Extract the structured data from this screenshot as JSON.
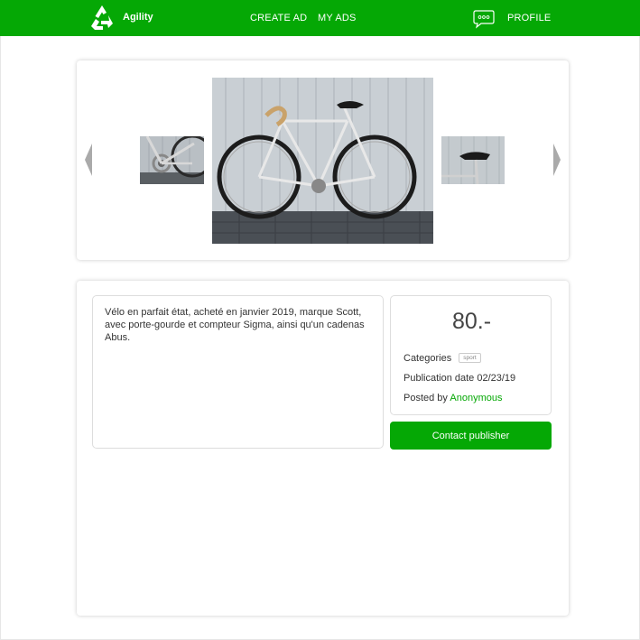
{
  "header": {
    "brand": "Agility",
    "nav": {
      "create_ad": "CREATE AD",
      "my_ads": "MY ADS",
      "profile": "PROFILE"
    },
    "icons": {
      "logo": "recycle-logo-icon",
      "messages": "chat-bubble-icon"
    },
    "accent_color": "#05a805"
  },
  "gallery": {
    "icons": {
      "prev": "arrow-left-icon",
      "next": "arrow-right-icon"
    },
    "images": [
      "bicycle-detail-thumbnail",
      "bicycle-main-photo",
      "bicycle-saddle-thumbnail"
    ]
  },
  "ad": {
    "description": "Vélo en parfait état, acheté en janvier 2019, marque Scott, avec porte-gourde et compteur Sigma, ainsi qu'un cadenas Abus.",
    "price": "80.-",
    "categories_label": "Categories",
    "category_tag": "sport",
    "publication_label": "Publication date",
    "publication_date": "02/23/19",
    "posted_by_label": "Posted by",
    "publisher": "Anonymous",
    "contact_button": "Contact publisher"
  }
}
